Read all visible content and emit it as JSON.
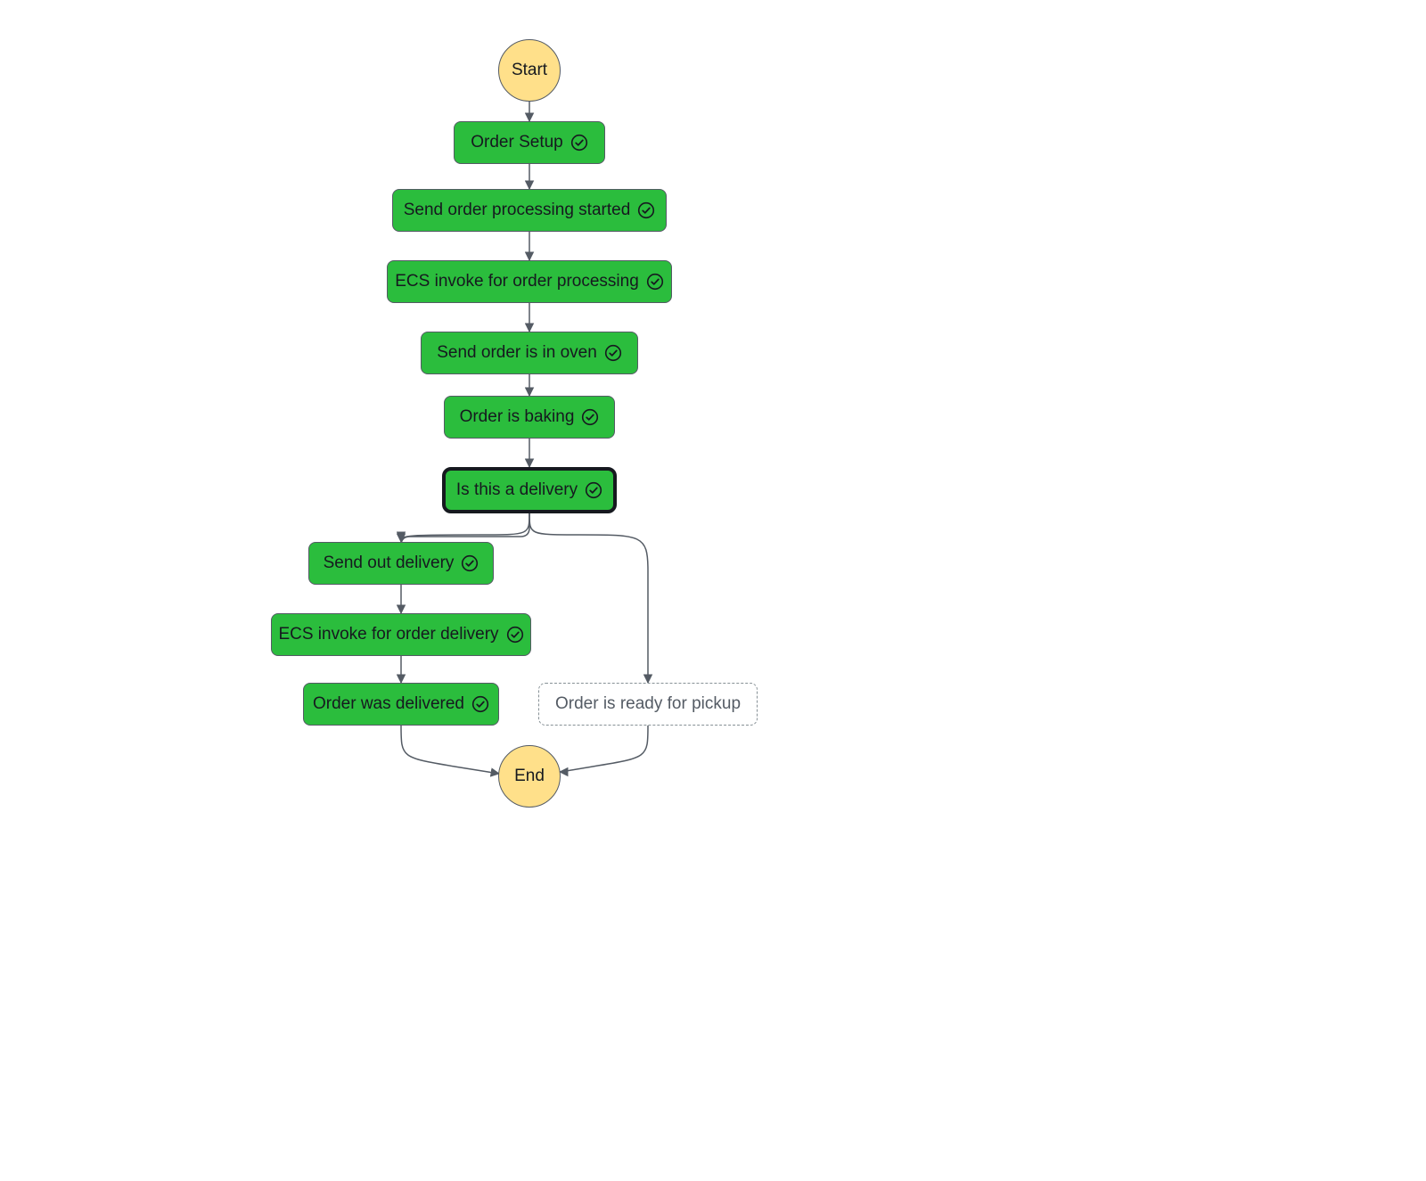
{
  "colors": {
    "step_bg": "#2bbd3d",
    "terminator_bg": "#ffe08a",
    "border": "#545b64",
    "inactive_border": "#879196",
    "text": "#16191f"
  },
  "nodes": {
    "start": "Start",
    "order_setup": "Order Setup",
    "send_processing_started": "Send order processing started",
    "ecs_processing": "ECS invoke for order processing",
    "send_in_oven": "Send order is in oven",
    "order_baking": "Order is baking",
    "is_delivery": "Is this a delivery",
    "send_out_delivery": "Send out delivery",
    "ecs_delivery": "ECS invoke for order delivery",
    "order_delivered": "Order was delivered",
    "order_pickup": "Order is ready for pickup",
    "end": "End"
  },
  "flow": {
    "type": "state-machine",
    "sequence": [
      "start",
      "order_setup",
      "send_processing_started",
      "ecs_processing",
      "send_in_oven",
      "order_baking",
      "is_delivery"
    ],
    "branches_from": "is_delivery",
    "branch_delivery": [
      "send_out_delivery",
      "ecs_delivery",
      "order_delivered"
    ],
    "branch_pickup": [
      "order_pickup"
    ],
    "merge_to": "end",
    "executed_path": [
      "start",
      "order_setup",
      "send_processing_started",
      "ecs_processing",
      "send_in_oven",
      "order_baking",
      "is_delivery",
      "send_out_delivery",
      "ecs_delivery",
      "order_delivered",
      "end"
    ],
    "selected": "is_delivery"
  }
}
